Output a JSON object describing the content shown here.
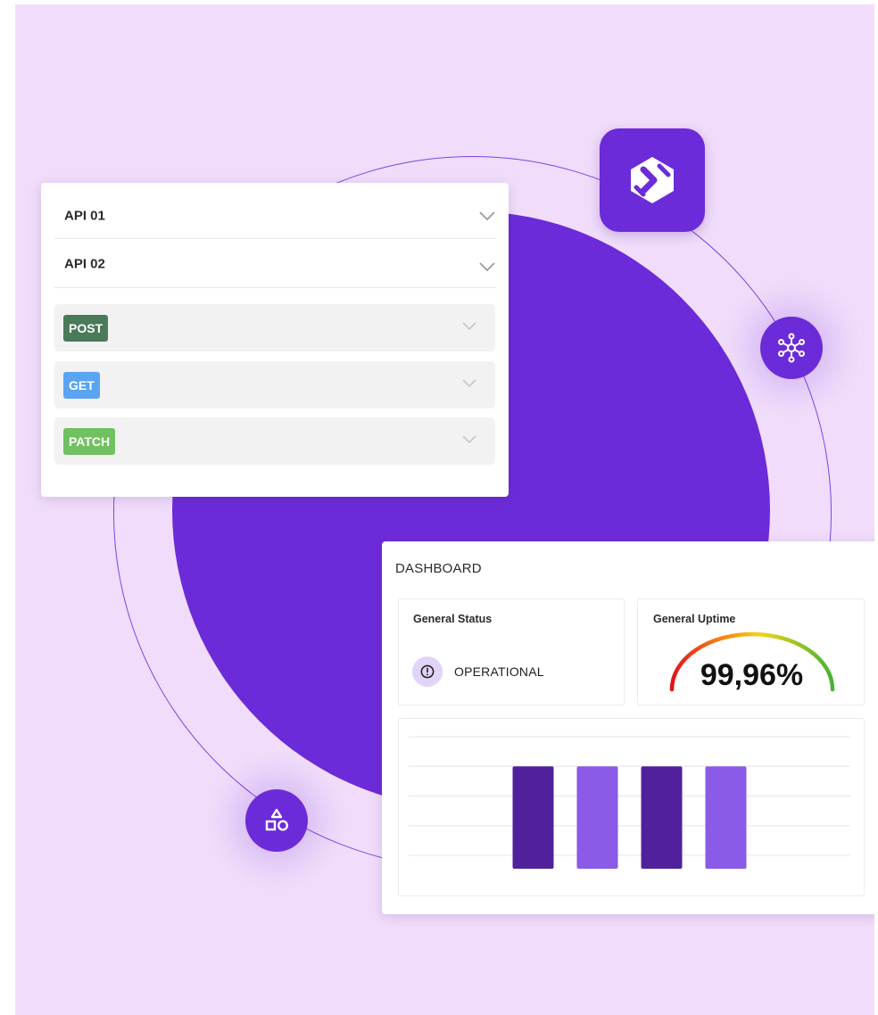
{
  "api_panel": {
    "sections": [
      {
        "label": "API 01"
      },
      {
        "label": "API 02"
      }
    ],
    "methods": [
      {
        "label": "POST",
        "color": "#4b7a5a"
      },
      {
        "label": "GET",
        "color": "#5aa4f2"
      },
      {
        "label": "PATCH",
        "color": "#71c160"
      }
    ]
  },
  "dashboard": {
    "title": "DASHBOARD",
    "status_card": {
      "title": "General Status",
      "value": "OPERATIONAL"
    },
    "uptime_card": {
      "title": "General Uptime",
      "value": "99,96%"
    }
  },
  "chart_data": {
    "type": "bar",
    "title": "",
    "xlabel": "",
    "ylabel": "",
    "ylim": [
      0,
      4
    ],
    "grid": true,
    "categories": [
      "",
      "",
      "",
      ""
    ],
    "values": [
      3,
      3,
      3,
      3
    ],
    "colors": [
      "#51219c",
      "#8b5ae6",
      "#51219c",
      "#8b5ae6"
    ]
  },
  "colors": {
    "background": "#f1ddfb",
    "brand": "#6c2bd9"
  },
  "icons": {
    "app_logo": "brand-logo-icon",
    "network": "network-hub-icon",
    "shapes": "shapes-icon",
    "status": "exclamation-circle-icon",
    "expand": "chevron-down-icon"
  }
}
